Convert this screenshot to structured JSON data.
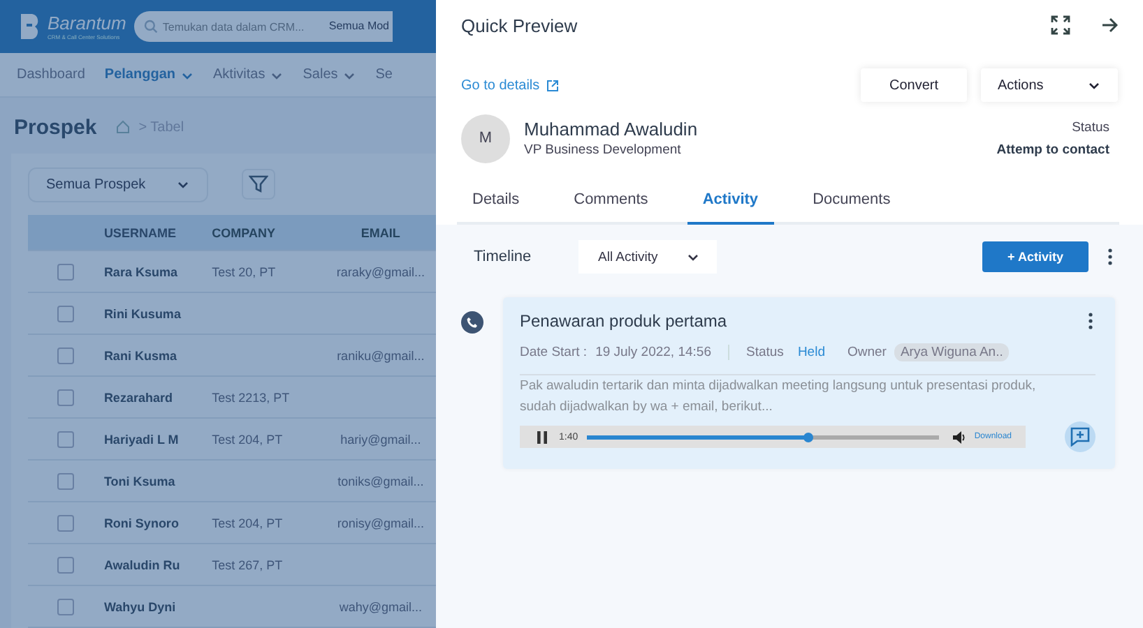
{
  "app": {
    "logo": {
      "name": "Barantum",
      "tagline": "CRM & Call Center Solutions"
    },
    "search": {
      "placeholder": "Temukan data dalam CRM...",
      "scope": "Semua Mod"
    },
    "nav": [
      {
        "label": "Dashboard",
        "selected": false,
        "dropdown": false
      },
      {
        "label": "Pelanggan",
        "selected": true,
        "dropdown": true
      },
      {
        "label": "Aktivitas",
        "selected": false,
        "dropdown": true
      },
      {
        "label": "Sales",
        "selected": false,
        "dropdown": true
      },
      {
        "label": "Se",
        "selected": false,
        "dropdown": false
      }
    ],
    "page_title": "Prospek",
    "breadcrumb": "> Tabel",
    "view_select": "Semua Prospek",
    "table": {
      "columns": [
        "USERNAME",
        "COMPANY",
        "EMAIL"
      ],
      "rows": [
        {
          "checked": false,
          "cells": [
            "Rara Ksuma",
            "Test 20, PT",
            "raraky@gmail..."
          ]
        },
        {
          "checked": false,
          "cells": [
            "Rini Kusuma",
            "",
            ""
          ]
        },
        {
          "checked": false,
          "cells": [
            "Rani Kusma",
            "",
            "raniku@gmail..."
          ]
        },
        {
          "checked": false,
          "cells": [
            "Rezarahard",
            "Test 2213, PT",
            ""
          ]
        },
        {
          "checked": false,
          "cells": [
            "Hariyadi L M",
            "Test 204, PT",
            "hariy@gmail..."
          ]
        },
        {
          "checked": false,
          "cells": [
            "Toni Ksuma",
            "",
            "toniks@gmail..."
          ]
        },
        {
          "checked": false,
          "cells": [
            "Roni Synoro",
            "Test 204, PT",
            "ronisy@gmail..."
          ]
        },
        {
          "checked": false,
          "cells": [
            "Awaludin Ru",
            "Test 267, PT",
            ""
          ]
        },
        {
          "checked": false,
          "cells": [
            "Wahyu Dyni",
            "",
            "wahy@gmail..."
          ]
        }
      ]
    }
  },
  "preview": {
    "title": "Quick Preview",
    "details_link": "Go to details",
    "buttons": {
      "convert": "Convert",
      "actions": "Actions"
    },
    "contact": {
      "initial": "M",
      "name": "Muhammad Awaludin",
      "job_title": "VP Business Development",
      "status_label": "Status",
      "status": "Attemp to contact"
    },
    "tabs": [
      {
        "label": "Details",
        "selected": false
      },
      {
        "label": "Comments",
        "selected": false
      },
      {
        "label": "Activity",
        "selected": true
      },
      {
        "label": "Documents",
        "selected": false
      }
    ],
    "timeline": {
      "label": "Timeline",
      "filter": "All Activity",
      "add_button": "+ Activity"
    },
    "activities": [
      {
        "title": "Penawaran produk pertama",
        "date_label": "Date Start :",
        "date": "19 July 2022, 14:56",
        "status_label": "Status",
        "status": "Held",
        "owner_label": "Owner",
        "owner": "Arya Wiguna An..",
        "note": "Pak awaludin tertarik dan minta dijadwalkan meeting langsung untuk presentasi produk, sudah dijadwalkan by wa + email, berikut...",
        "recording": {
          "playing": true,
          "time": "1:40",
          "level": 0.63,
          "download": "Download"
        }
      }
    ]
  }
}
